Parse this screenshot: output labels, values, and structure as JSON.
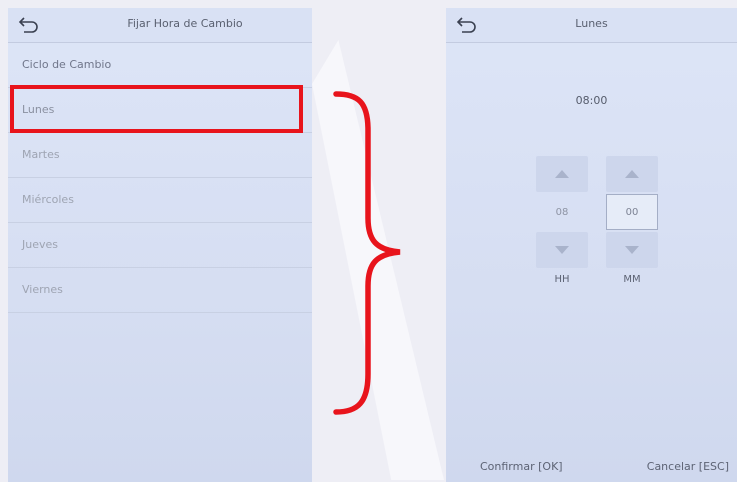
{
  "left_screen": {
    "title": "Fijar Hora de Cambio",
    "menu": [
      {
        "label": "Ciclo de Cambio"
      },
      {
        "label": "Lunes"
      },
      {
        "label": "Martes"
      },
      {
        "label": "Miércoles"
      },
      {
        "label": "Jueves"
      },
      {
        "label": "Viernes"
      }
    ],
    "highlighted_item": "Lunes",
    "highlight_color": "#e8141c"
  },
  "right_screen": {
    "title": "Lunes",
    "time": "08:00",
    "hour": {
      "value": "08",
      "label": "HH"
    },
    "minute": {
      "value": "00",
      "label": "MM"
    },
    "confirm_label": "Confirmar [OK]",
    "cancel_label": "Cancelar [ESC]"
  },
  "annotation_color": "#e8141c"
}
